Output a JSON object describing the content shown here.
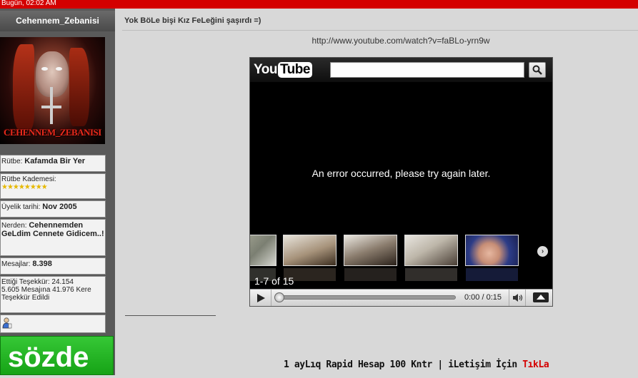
{
  "topbar": {
    "text": "Bugün, 02:02 AM"
  },
  "sidebar": {
    "username": "Cehennem_Zebanisi",
    "avatar_caption": "CEHENNEM_ZEBANISI",
    "rank_label": "Rütbe:",
    "rank_value": "Kafamda Bir Yer",
    "rank_level_label": "Rütbe Kademesi:",
    "rank_stars": "★★★★★★★★",
    "join_label": "Üyelik tarihi:",
    "join_value": "Nov 2005",
    "from_label": "Nerden:",
    "from_value": "Cehennemden GeLdim Cennete Gidicem..!",
    "posts_label": "Mesajlar:",
    "posts_value": "8.398",
    "thanks_text": "Ettiği Teşekkür: 24.154",
    "thanked_text": "5.605 Mesajına 41.976 Kere Teşekkür Edildi",
    "sozde_label": "sözde"
  },
  "post": {
    "title": "Yok BöLe bişi Kız FeLeğini şaşırdı =)",
    "video_url": "http://www.youtube.com/watch?v=faBLo-yrn9w"
  },
  "player": {
    "logo_you": "You",
    "logo_tube": "Tube",
    "search_value": "",
    "error": "An error occurred, please try again later.",
    "count": "1-7 of 15",
    "time": "0:00 / 0:15",
    "next_icon": "›",
    "progress_fraction": 0.0
  },
  "footer": {
    "text": "1 ayLıq Rapid Hesap 100 Kntr | iLetişim İçin ",
    "link": "TıkLa"
  },
  "colors": {
    "topbar": "#d40000",
    "sozde": "#22b422",
    "link": "#d40000"
  }
}
